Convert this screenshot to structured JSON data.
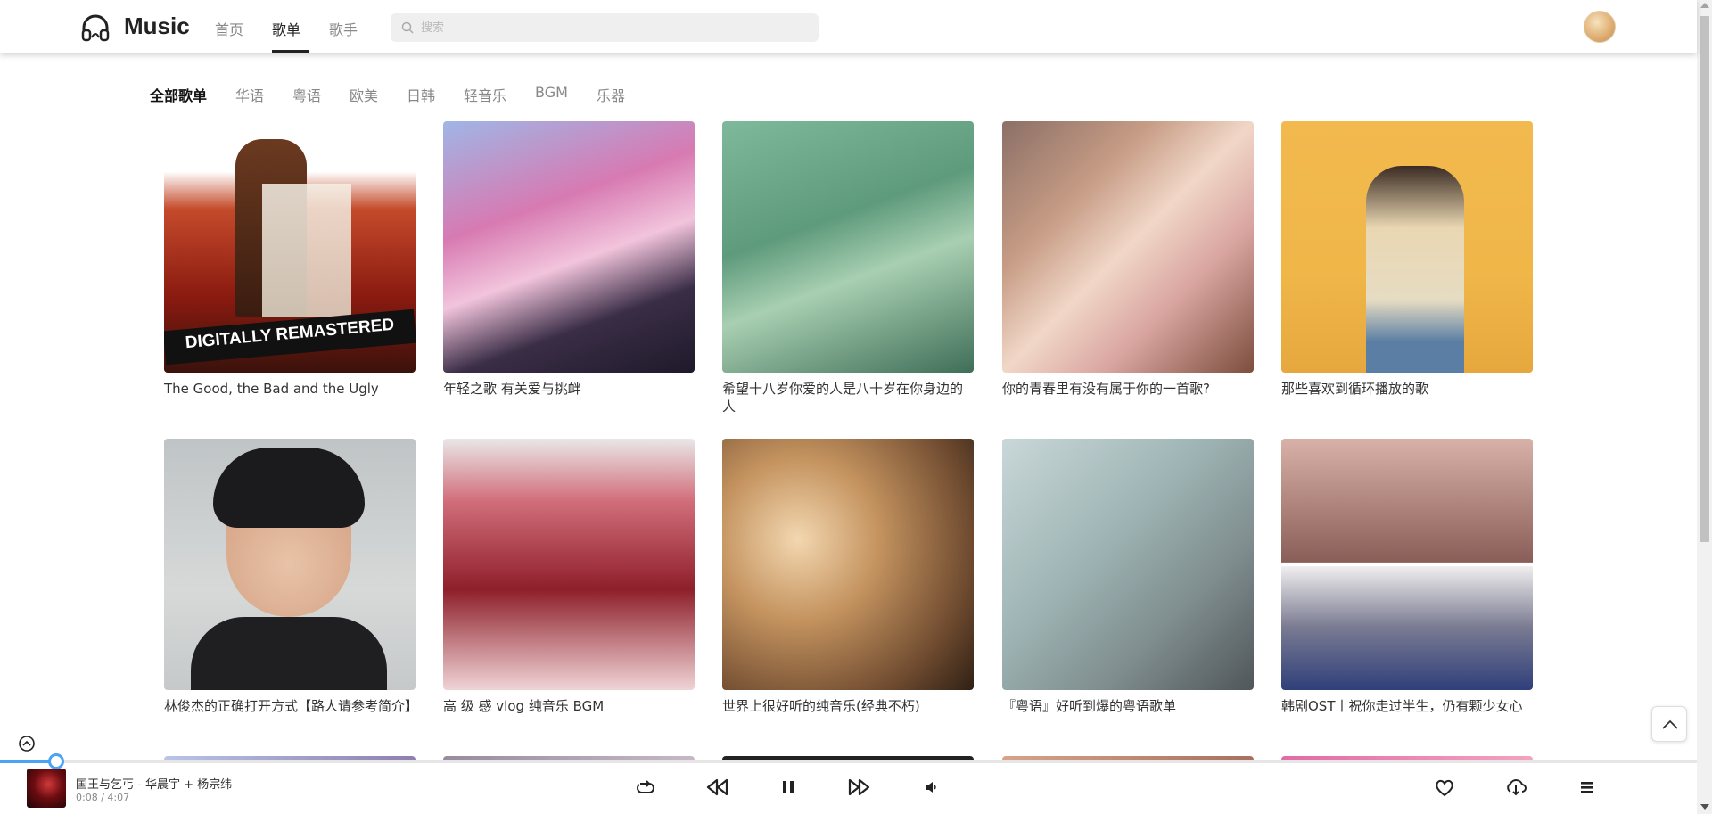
{
  "header": {
    "logo_text": "Music",
    "nav": [
      {
        "label": "首页",
        "active": false
      },
      {
        "label": "歌单",
        "active": true
      },
      {
        "label": "歌手",
        "active": false
      }
    ],
    "search_placeholder": "搜索"
  },
  "categories": [
    "全部歌单",
    "华语",
    "粤语",
    "欧美",
    "日韩",
    "轻音乐",
    "BGM",
    "乐器"
  ],
  "active_category": "全部歌单",
  "playlists": [
    {
      "title": "The Good, the Bad and the Ugly",
      "cover_text": "DIGITALLY REMASTERED"
    },
    {
      "title": "年轻之歌 有关爱与挑衅"
    },
    {
      "title": "希望十八岁你爱的人是八十岁在你身边的人"
    },
    {
      "title": "你的青春里有没有属于你的一首歌?"
    },
    {
      "title": "那些喜欢到循环播放的歌"
    },
    {
      "title": "林俊杰的正确打开方式【路人请参考简介】"
    },
    {
      "title": "高 级 感 vlog 纯音乐 BGM"
    },
    {
      "title": "世界上很好听的纯音乐(经典不朽)"
    },
    {
      "title": "『粤语』好听到爆的粤语歌单"
    },
    {
      "title": "韩剧OST丨祝你走过半生，仍有颗少女心"
    }
  ],
  "player": {
    "song": "国王与乞丐 - 华晨宇 + 杨宗纬",
    "time": "0:08 / 4:07",
    "progress": 0.033,
    "controls": [
      "loop-icon",
      "previous-icon",
      "pause-icon",
      "next-icon",
      "volume-icon",
      "heart-icon",
      "download-icon",
      "playlist-icon"
    ]
  },
  "colors": {
    "accent": "#4aa3f5",
    "text": "#333333",
    "muted": "#888888"
  }
}
